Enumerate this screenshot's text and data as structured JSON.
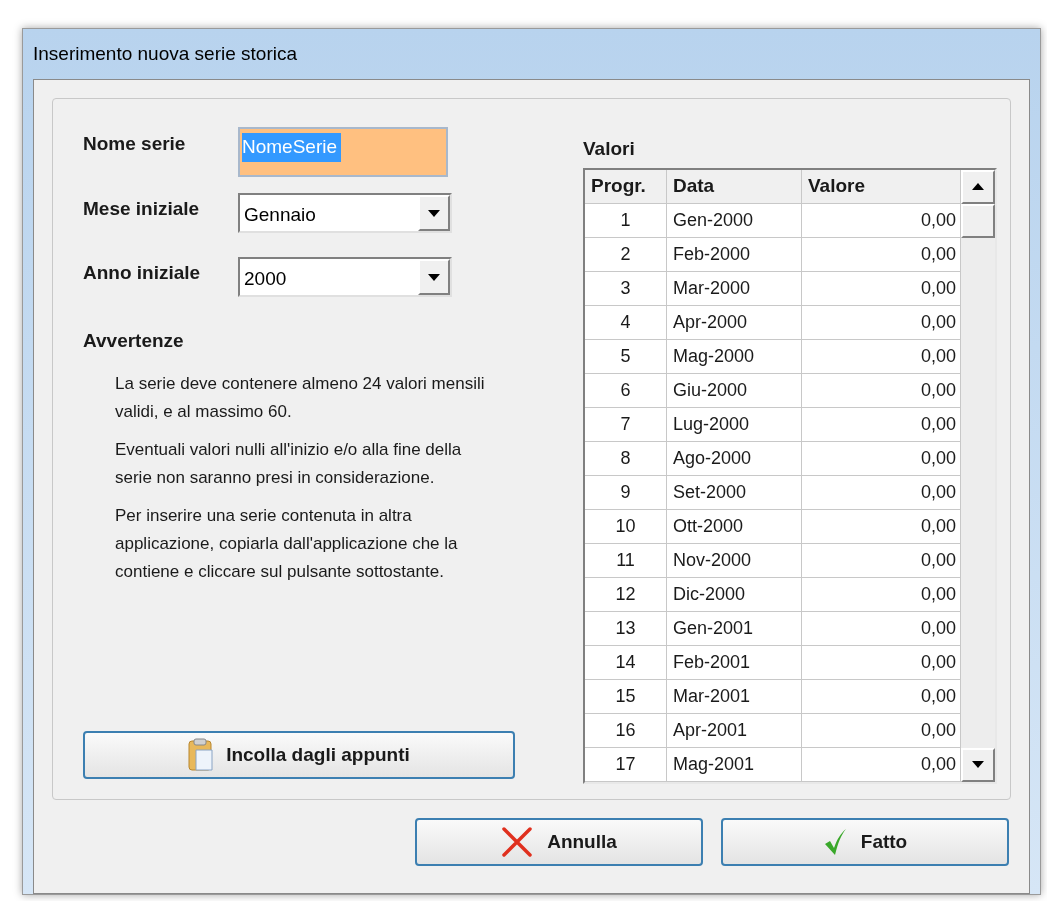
{
  "window": {
    "title": "Inserimento nuova serie storica"
  },
  "form": {
    "name_label": "Nome serie",
    "name_value": "NomeSerie",
    "month_label": "Mese iniziale",
    "month_value": "Gennaio",
    "year_label": "Anno iniziale",
    "year_value": "2000"
  },
  "warnings": {
    "title": "Avvertenze",
    "paragraphs": [
      "La serie deve contenere almeno 24 valori mensili validi, e al massimo 60.",
      "Eventuali valori nulli all'inizio e/o alla fine della serie non saranno presi in considerazione.",
      "Per inserire una serie contenuta in altra applicazione, copiarla dall'applicazione che la contiene e cliccare sul pulsante sottostante."
    ]
  },
  "paste_button": "Incolla dagli appunti",
  "table": {
    "title": "Valori",
    "columns": [
      "Progr.",
      "Data",
      "Valore"
    ],
    "rows": [
      [
        "1",
        "Gen-2000",
        "0,00"
      ],
      [
        "2",
        "Feb-2000",
        "0,00"
      ],
      [
        "3",
        "Mar-2000",
        "0,00"
      ],
      [
        "4",
        "Apr-2000",
        "0,00"
      ],
      [
        "5",
        "Mag-2000",
        "0,00"
      ],
      [
        "6",
        "Giu-2000",
        "0,00"
      ],
      [
        "7",
        "Lug-2000",
        "0,00"
      ],
      [
        "8",
        "Ago-2000",
        "0,00"
      ],
      [
        "9",
        "Set-2000",
        "0,00"
      ],
      [
        "10",
        "Ott-2000",
        "0,00"
      ],
      [
        "11",
        "Nov-2000",
        "0,00"
      ],
      [
        "12",
        "Dic-2000",
        "0,00"
      ],
      [
        "13",
        "Gen-2001",
        "0,00"
      ],
      [
        "14",
        "Feb-2001",
        "0,00"
      ],
      [
        "15",
        "Mar-2001",
        "0,00"
      ],
      [
        "16",
        "Apr-2001",
        "0,00"
      ],
      [
        "17",
        "Mag-2001",
        "0,00"
      ]
    ]
  },
  "buttons": [
    {
      "kind": "cancel",
      "label": "Annulla"
    },
    {
      "kind": "ok",
      "label": "Fatto"
    }
  ]
}
